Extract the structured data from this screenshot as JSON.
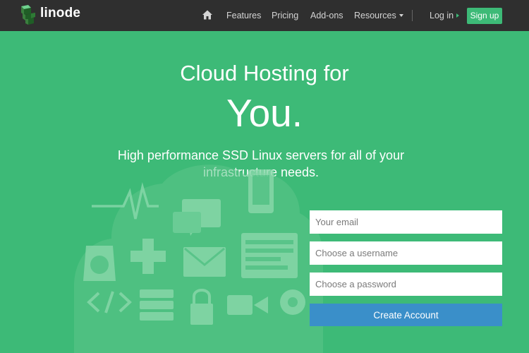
{
  "brand": {
    "name": "linode",
    "logo_icon": "linode-cube-icon"
  },
  "nav": {
    "home_icon": "home-icon",
    "items": [
      {
        "label": "Features"
      },
      {
        "label": "Pricing"
      },
      {
        "label": "Add-ons"
      },
      {
        "label": "Resources",
        "icon": "caret-down-icon"
      }
    ],
    "login": {
      "label": "Log in",
      "icon": "caret-right-icon"
    },
    "signup": {
      "label": "Sign up"
    }
  },
  "hero": {
    "title": "Cloud Hosting for",
    "emphasis": "You.",
    "subtitle": "High performance SSD Linux servers for all of your infrastructure needs."
  },
  "form": {
    "email_placeholder": "Your email",
    "username_placeholder": "Choose a username",
    "password_placeholder": "Choose a password",
    "submit_label": "Create Account"
  },
  "colors": {
    "brand_green": "#3dba77",
    "topbar": "#2f2f2f",
    "button_blue": "#3a8fc9"
  }
}
